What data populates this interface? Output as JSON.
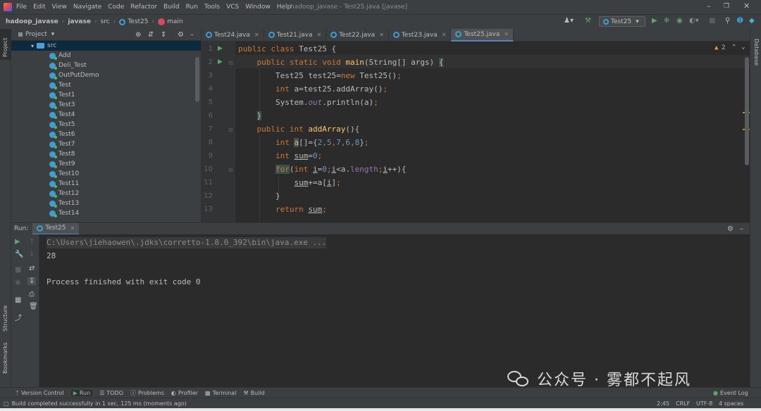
{
  "menubar": {
    "items": [
      "File",
      "Edit",
      "View",
      "Navigate",
      "Code",
      "Refactor",
      "Build",
      "Run",
      "Tools",
      "VCS",
      "Window",
      "Help"
    ],
    "title": "hadoop_javase - Test25.java [javase]"
  },
  "navbar": {
    "crumbs": [
      "hadoop_javase",
      "javase",
      "src",
      "Test25",
      "main"
    ],
    "run_config": "Test25"
  },
  "project": {
    "header": "Project",
    "src_folder": "src",
    "classes": [
      "Add",
      "Deli_Test",
      "OutPutDemo",
      "Test",
      "Test1",
      "Test3",
      "Test4",
      "Test5",
      "Test6",
      "Test7",
      "Test8",
      "Test9",
      "Test10",
      "Test11",
      "Test12",
      "Test13",
      "Test14"
    ]
  },
  "editor": {
    "tabs": [
      "Test24.java",
      "Test21.java",
      "Test22.java",
      "Test23.java",
      "Test25.java"
    ],
    "active_tab": "Test25.java",
    "warning_count": "2",
    "line_numbers": [
      "1",
      "2",
      "3",
      "4",
      "5",
      "6",
      "7",
      "8",
      "9",
      "10",
      "11",
      "12",
      "13"
    ],
    "code": {
      "l1": "public class Test25 {",
      "l2": "    public static void main(String[] args) {",
      "l3": "        Test25 test25=new Test25();",
      "l4": "        int a=test25.addArray();",
      "l5": "        System.out.println(a);",
      "l6": "    }",
      "l7": "    public int addArray(){",
      "l8": "        int a[]={2,5,7,6,8};",
      "l9": "        int sum=0;",
      "l10": "        for(int i=0;i<a.length;i++){",
      "l11": "            sum+=a[i];",
      "l12": "        }",
      "l13": "        return sum;"
    }
  },
  "run": {
    "label": "Run:",
    "tab": "Test25",
    "command": "C:\\Users\\jiehaowen\\.jdks\\corretto-1.8.0_392\\bin\\java.exe ...",
    "output": "28",
    "exit_message": "Process finished with exit code 0"
  },
  "left_stripe": {
    "project": "Project",
    "structure": "Structure",
    "bookmarks": "Bookmarks"
  },
  "right_stripe": {
    "database": "Database"
  },
  "bottom_tools": [
    "Version Control",
    "Run",
    "TODO",
    "Problems",
    "Profiler",
    "Terminal",
    "Build"
  ],
  "event_log": "Event Log",
  "status": {
    "message": "Build completed successfully in 1 sec, 125 ms (moments ago)",
    "position": "2:45",
    "line_sep": "CRLF",
    "encoding": "UTF-8",
    "indent": "4 spaces"
  },
  "watermark": "公众号 · 雾都不起风",
  "colors": {
    "editor_bg": "#2b2b2b",
    "panel_bg": "#3c3f41",
    "keyword": "#cc7832",
    "method": "#ffc66d",
    "number": "#6897bb",
    "field": "#9876aa",
    "run_green": "#59a869"
  },
  "icons": [
    "intellij-logo-icon",
    "java-class-icon",
    "folder-icon",
    "run-icon",
    "debug-icon",
    "stop-icon",
    "gear-icon",
    "close-icon",
    "search-icon",
    "wrench-icon"
  ]
}
